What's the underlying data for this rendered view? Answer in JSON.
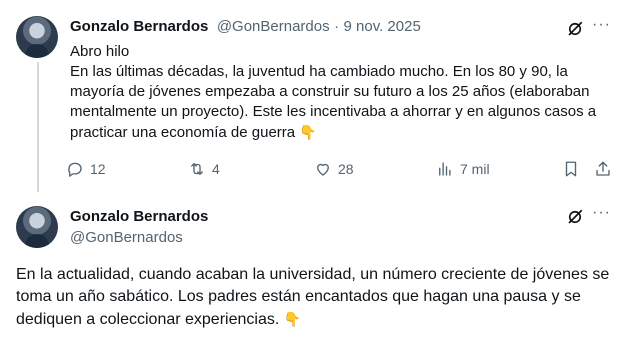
{
  "tweet1": {
    "author_name": "Gonzalo Bernardos",
    "handle": "@GonBernardos",
    "separator": "·",
    "date": "9 nov. 2025",
    "more_label": "···",
    "text_line1": "Abro hilo",
    "text_line2": "En las últimas décadas, la juventud ha cambiado mucho. En los 80 y 90, la mayoría de jóvenes empezaba a construir su futuro a los 25 años (elaboraban mentalmente un proyecto). Este les incentivaba a ahorrar y en algunos casos a practicar una economía de guerra",
    "emoji": "👇",
    "replies": "12",
    "retweets": "4",
    "likes": "28",
    "views": "7 mil"
  },
  "tweet2": {
    "author_name": "Gonzalo Bernardos",
    "handle": "@GonBernardos",
    "more_label": "···",
    "text": "En la actualidad, cuando acaban la universidad, un número creciente de jóvenes se toma un año sabático. Los padres están encantados que hagan una pausa y se dediquen a coleccionar experiencias.",
    "emoji": "👇"
  },
  "colors": {
    "text": "#0f1419",
    "muted": "#536471",
    "thread_line": "#cfd9de",
    "emoji": "#f4b400"
  },
  "icons": [
    "avatar",
    "grok-icon",
    "more-icon",
    "reply-icon",
    "retweet-icon",
    "like-icon",
    "views-icon",
    "bookmark-icon",
    "share-icon",
    "pointing-down-emoji"
  ]
}
